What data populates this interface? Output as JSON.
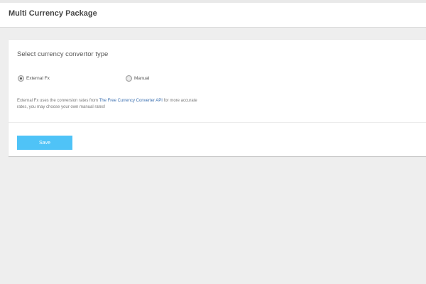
{
  "header": {
    "title": "Multi Currency Package"
  },
  "panel": {
    "section_title": "Select currency convertor type",
    "options": [
      {
        "label": "External Fx",
        "checked": true
      },
      {
        "label": "Manual",
        "checked": false
      }
    ],
    "description": {
      "before": "External Fx uses the conversion rates from ",
      "link": "The Free Currency Converter API",
      "after": " for more accurate rates, you may choose your own manual rates!"
    },
    "save_label": "Save"
  },
  "colors": {
    "accent": "#4fc3f7",
    "link": "#3a6fb0",
    "background": "#eeeeee"
  }
}
